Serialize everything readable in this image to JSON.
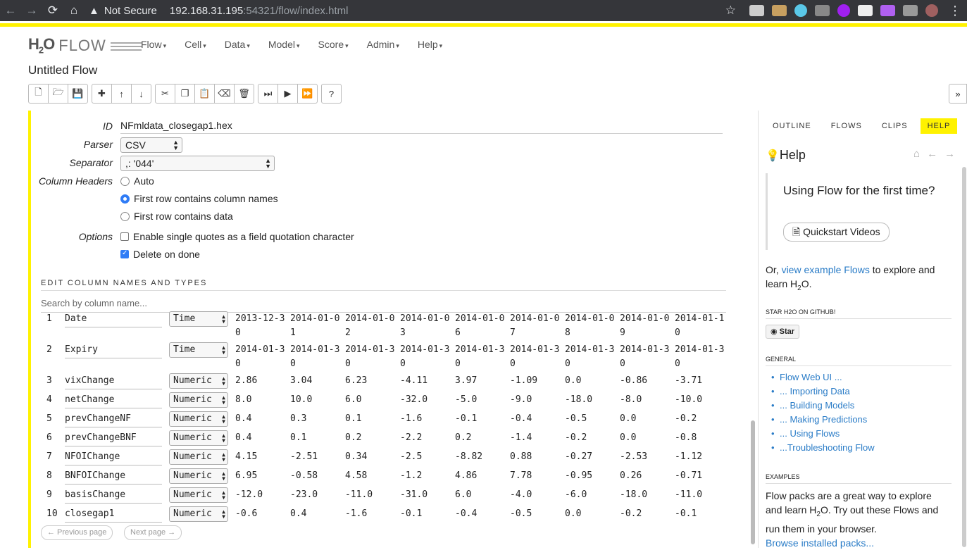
{
  "browser": {
    "security": "Not Secure",
    "url_host": "192.168.31.195",
    "url_rest": ":54321/flow/index.html"
  },
  "app": {
    "logo_h": "H",
    "logo_sub": "2",
    "logo_o": "O",
    "logo_flow": "FLOW",
    "menu": [
      "Flow",
      "Cell",
      "Data",
      "Model",
      "Score",
      "Admin",
      "Help"
    ],
    "flow_title": "Untitled Flow"
  },
  "parse": {
    "id_label": "ID",
    "id_value": "NFmldata_closegap1.hex",
    "parser_label": "Parser",
    "parser_value": "CSV",
    "separator_label": "Separator",
    "separator_value": ",: '044'",
    "column_headers_label": "Column Headers",
    "header_options": [
      "Auto",
      "First row contains column names",
      "First row contains data"
    ],
    "header_selected": 1,
    "options_label": "Options",
    "option_quotes": "Enable single quotes as a field quotation character",
    "option_quotes_checked": false,
    "option_delete": "Delete on done",
    "option_delete_checked": true,
    "section_title": "EDIT COLUMN NAMES AND TYPES",
    "search_placeholder": "Search by column name...",
    "prev_page": "← Previous page",
    "next_page": "Next page →"
  },
  "columns": [
    {
      "num": "1",
      "name": "Date",
      "type": "Time",
      "values": [
        "2013-12-30",
        "2014-01-01",
        "2014-01-02",
        "2014-01-03",
        "2014-01-06",
        "2014-01-07",
        "2014-01-08",
        "2014-01-09",
        "2014-01-10"
      ]
    },
    {
      "num": "2",
      "name": "Expiry",
      "type": "Time",
      "values": [
        "2014-01-30",
        "2014-01-30",
        "2014-01-30",
        "2014-01-30",
        "2014-01-30",
        "2014-01-30",
        "2014-01-30",
        "2014-01-30",
        "2014-01-30"
      ]
    },
    {
      "num": "3",
      "name": "vixChange",
      "type": "Numeric",
      "values": [
        "2.86",
        "3.04",
        "6.23",
        "-4.11",
        "3.97",
        "-1.09",
        "0.0",
        "-0.86",
        "-3.71"
      ]
    },
    {
      "num": "4",
      "name": "netChange",
      "type": "Numeric",
      "values": [
        "8.0",
        "10.0",
        "6.0",
        "-32.0",
        "-5.0",
        "-9.0",
        "-18.0",
        "-8.0",
        "-10.0"
      ]
    },
    {
      "num": "5",
      "name": "prevChangeNF",
      "type": "Numeric",
      "values": [
        "0.4",
        "0.3",
        "0.1",
        "-1.6",
        "-0.1",
        "-0.4",
        "-0.5",
        "0.0",
        "-0.2"
      ]
    },
    {
      "num": "6",
      "name": "prevChangeBNF",
      "type": "Numeric",
      "values": [
        "0.4",
        "0.1",
        "0.2",
        "-2.2",
        "0.2",
        "-1.4",
        "-0.2",
        "0.0",
        "-0.8"
      ]
    },
    {
      "num": "7",
      "name": "NFOIChange",
      "type": "Numeric",
      "values": [
        "4.15",
        "-2.51",
        "0.34",
        "-2.5",
        "-8.82",
        "0.88",
        "-0.27",
        "-2.53",
        "-1.12"
      ]
    },
    {
      "num": "8",
      "name": "BNFOIChange",
      "type": "Numeric",
      "values": [
        "6.95",
        "-0.58",
        "4.58",
        "-1.2",
        "4.86",
        "7.78",
        "-0.95",
        "0.26",
        "-0.71"
      ]
    },
    {
      "num": "9",
      "name": "basisChange",
      "type": "Numeric",
      "values": [
        "-12.0",
        "-23.0",
        "-11.0",
        "-31.0",
        "6.0",
        "-4.0",
        "-6.0",
        "-18.0",
        "-11.0"
      ]
    },
    {
      "num": "10",
      "name": "closegap1",
      "type": "Numeric",
      "values": [
        "-0.6",
        "0.4",
        "-1.6",
        "-0.1",
        "-0.4",
        "-0.5",
        "0.0",
        "-0.2",
        "-0.1"
      ]
    }
  ],
  "sidebar": {
    "tabs": [
      "OUTLINE",
      "FLOWS",
      "CLIPS",
      "HELP"
    ],
    "active_tab": 3,
    "help_title": "Help",
    "callout_text": "Using Flow for the first time?",
    "quickstart": "Quickstart Videos",
    "or_text": "Or,",
    "example_link": "view example Flows",
    "explore_text": "to explore and learn H",
    "explore_sub": "2",
    "explore_end": "O.",
    "star_head": "STAR H2O ON GITHUB!",
    "star_btn": "Star",
    "general_head": "GENERAL",
    "general_links": [
      "Flow Web UI ...",
      "... Importing Data",
      "... Building Models",
      "... Making Predictions",
      "... Using Flows",
      "...Troubleshooting Flow"
    ],
    "examples_head": "EXAMPLES",
    "examples_text1": "Flow packs are a great way to explore and learn H",
    "examples_sub": "2",
    "examples_text2": "O. Try out these Flows and run them in your browser.",
    "browse_link": "Browse installed packs..."
  }
}
